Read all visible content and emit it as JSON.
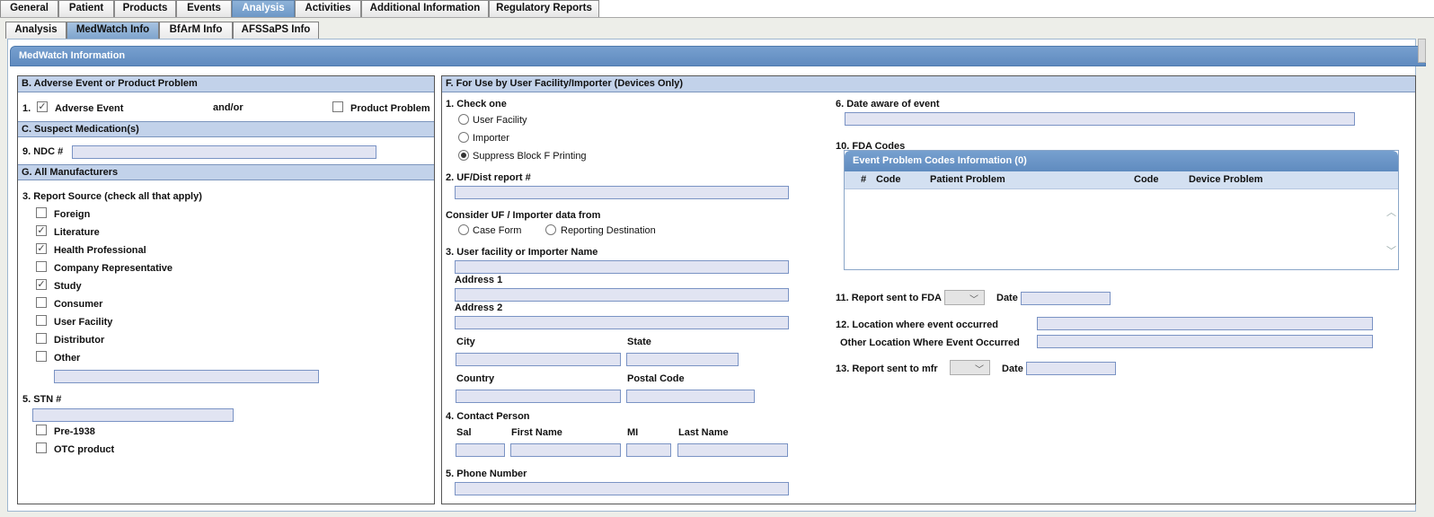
{
  "top_tabs": [
    "General",
    "Patient",
    "Products",
    "Events",
    "Analysis",
    "Activities",
    "Additional Information",
    "Regulatory Reports"
  ],
  "sub_tabs": [
    "Analysis",
    "MedWatch Info",
    "BfArM Info",
    "AFSSaPS Info"
  ],
  "header": {
    "title": "MedWatch Information"
  },
  "left": {
    "section_b": "B. Adverse Event or Product Problem",
    "item1_num": "1.",
    "adverse_event": "Adverse Event",
    "andor": "and/or",
    "product_problem": "Product Problem",
    "section_c": "C. Suspect Medication(s)",
    "ndc_label": "9. NDC #",
    "section_g": "G. All Manufacturers",
    "report_source": "3. Report Source (check all that apply)",
    "sources": [
      {
        "label": "Foreign",
        "checked": false
      },
      {
        "label": "Literature",
        "checked": true
      },
      {
        "label": "Health Professional",
        "checked": true
      },
      {
        "label": "Company Representative",
        "checked": false
      },
      {
        "label": "Study",
        "checked": true
      },
      {
        "label": "Consumer",
        "checked": false
      },
      {
        "label": "User Facility",
        "checked": false
      },
      {
        "label": "Distributor",
        "checked": false
      },
      {
        "label": "Other",
        "checked": false
      }
    ],
    "stn_label": "5. STN #",
    "pre1938": "Pre-1938",
    "otc": "OTC product"
  },
  "right": {
    "section_f": "F. For Use by User Facility/Importer (Devices Only)",
    "check_one": "1. Check one",
    "check_options": [
      "User Facility",
      "Importer",
      "Suppress Block F Printing"
    ],
    "uf_report": "2. UF/Dist report #",
    "consider": "Consider UF / Importer data from",
    "consider_options": [
      "Case Form",
      "Reporting Destination"
    ],
    "facility_name": "3. User facility or Importer Name",
    "address1": "Address 1",
    "address2": "Address 2",
    "city": "City",
    "state": "State",
    "country": "Country",
    "postal": "Postal Code",
    "contact": "4. Contact Person",
    "sal": "Sal",
    "first": "First Name",
    "mi": "MI",
    "last": "Last Name",
    "phone": "5. Phone Number",
    "date_aware": "6. Date aware of event",
    "fda_codes": "10. FDA Codes",
    "grid_title": "Event Problem Codes Information (0)",
    "grid_cols": [
      "#",
      "Code",
      "Patient Problem",
      "Code",
      "Device Problem"
    ],
    "report_fda": "11. Report sent to FDA",
    "date1": "Date",
    "location": "12. Location where event occurred",
    "other_location": "Other Location Where Event Occurred",
    "report_mfr": "13. Report sent to mfr",
    "date2": "Date"
  }
}
